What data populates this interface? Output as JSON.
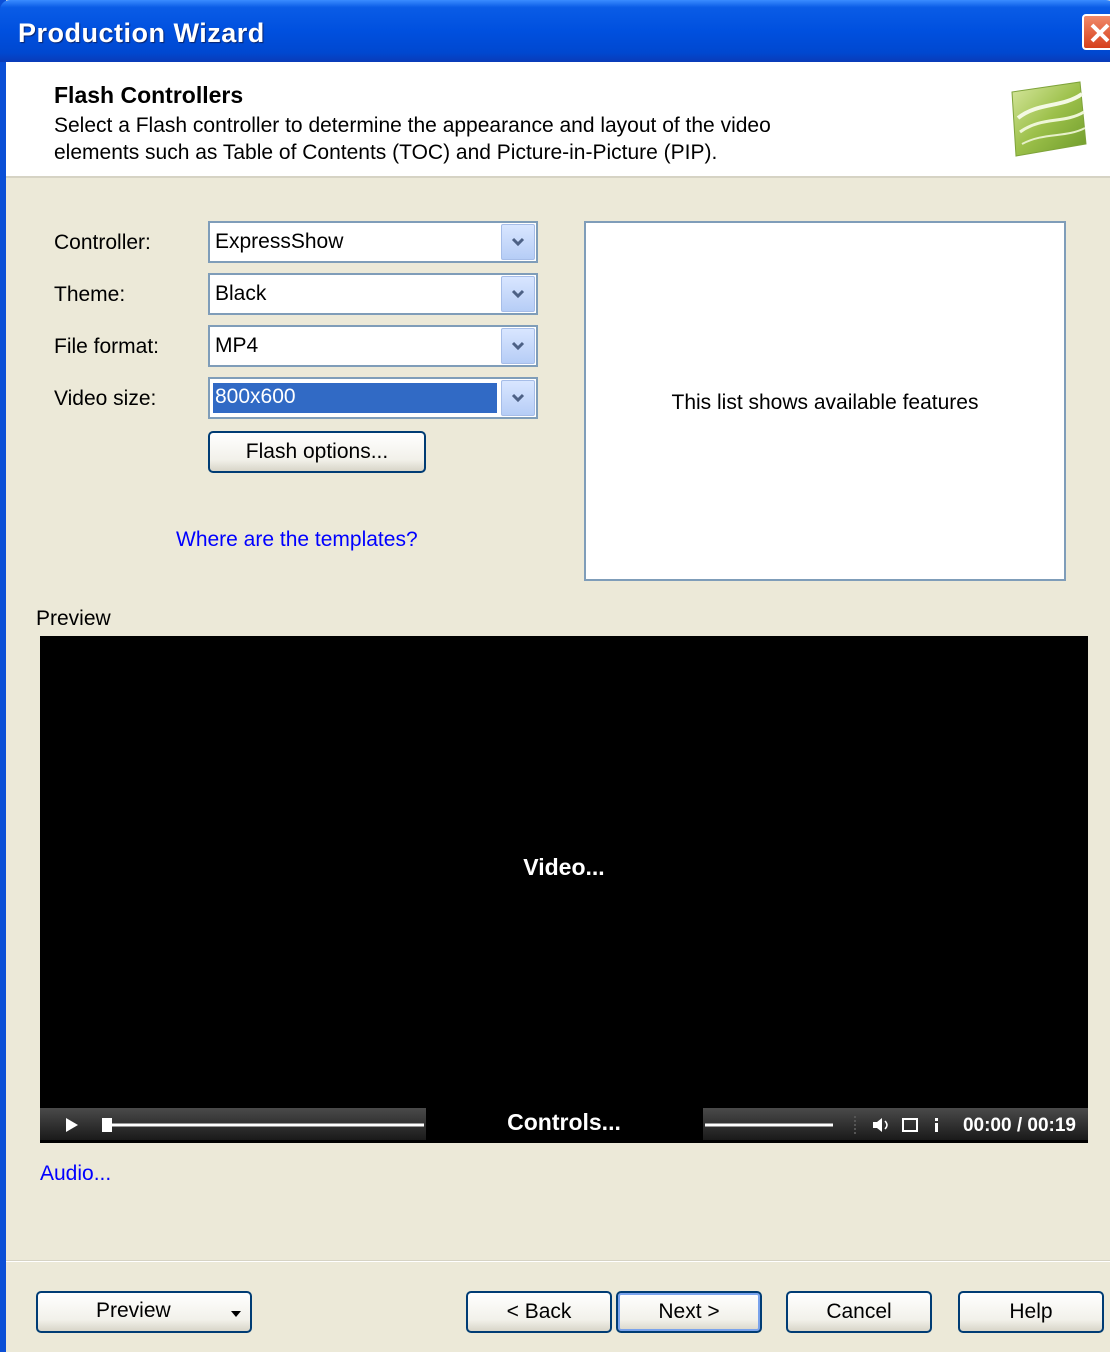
{
  "window": {
    "title": "Production Wizard"
  },
  "header": {
    "title": "Flash Controllers",
    "description_line1": "Select a Flash controller to determine the appearance and layout of the video",
    "description_line2": "elements such as Table of Contents (TOC) and Picture-in-Picture (PIP)."
  },
  "form": {
    "controller": {
      "label": "Controller:",
      "value": "ExpressShow"
    },
    "theme": {
      "label": "Theme:",
      "value": "Black"
    },
    "file_format": {
      "label": "File format:",
      "value": "MP4"
    },
    "video_size": {
      "label": "Video size:",
      "value": "800x600"
    },
    "flash_options_label": "Flash options...",
    "templates_link": "Where are the templates?"
  },
  "features": {
    "text": "This list shows available features"
  },
  "preview": {
    "label": "Preview",
    "video_text": "Video...",
    "controls_text": "Controls...",
    "time": "00:00 / 00:19"
  },
  "audio_link": "Audio...",
  "footer": {
    "preview_label": "Preview",
    "back_label": "< Back",
    "next_label": "Next >",
    "cancel_label": "Cancel",
    "help_label": "Help"
  },
  "colors": {
    "titlebar": "#0050df",
    "selection": "#316ac5",
    "link": "#0000ff"
  }
}
